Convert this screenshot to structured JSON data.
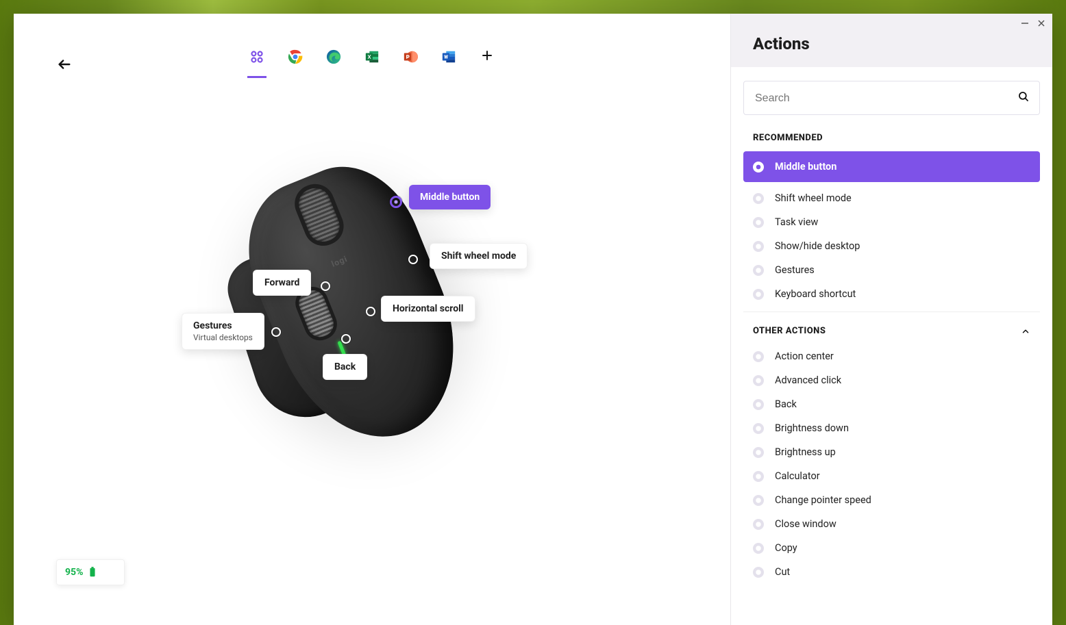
{
  "colors": {
    "accent": "#7e52e8",
    "battery_ok": "#13b24b"
  },
  "window": {
    "panel_title": "Actions"
  },
  "top_apps": [
    {
      "id": "all",
      "name": "all-applications",
      "active": true
    },
    {
      "id": "chrome",
      "name": "google-chrome",
      "active": false
    },
    {
      "id": "edge",
      "name": "microsoft-edge",
      "active": false
    },
    {
      "id": "excel",
      "name": "microsoft-excel",
      "active": false
    },
    {
      "id": "powerpoint",
      "name": "microsoft-powerpoint",
      "active": false
    },
    {
      "id": "word",
      "name": "microsoft-word",
      "active": false
    },
    {
      "id": "add",
      "name": "add-application",
      "active": false
    }
  ],
  "device": {
    "brand": "logi"
  },
  "callouts": {
    "middle": {
      "label": "Middle button",
      "selected": true
    },
    "shift_wheel": {
      "label": "Shift wheel mode"
    },
    "forward": {
      "label": "Forward"
    },
    "hscroll": {
      "label": "Horizontal scroll"
    },
    "gestures": {
      "label": "Gestures",
      "sub": "Virtual desktops"
    },
    "back": {
      "label": "Back"
    }
  },
  "battery": {
    "level_text": "95%"
  },
  "search": {
    "placeholder": "Search"
  },
  "sections": {
    "recommended_label": "RECOMMENDED",
    "other_label": "OTHER ACTIONS"
  },
  "recommended": [
    {
      "label": "Middle button",
      "selected": true
    },
    {
      "label": "Shift wheel mode"
    },
    {
      "label": "Task view"
    },
    {
      "label": "Show/hide desktop"
    },
    {
      "label": "Gestures"
    },
    {
      "label": "Keyboard shortcut"
    }
  ],
  "other": [
    {
      "label": "Action center"
    },
    {
      "label": "Advanced click"
    },
    {
      "label": "Back"
    },
    {
      "label": "Brightness down"
    },
    {
      "label": "Brightness up"
    },
    {
      "label": "Calculator"
    },
    {
      "label": "Change pointer speed"
    },
    {
      "label": "Close window"
    },
    {
      "label": "Copy"
    },
    {
      "label": "Cut"
    }
  ]
}
